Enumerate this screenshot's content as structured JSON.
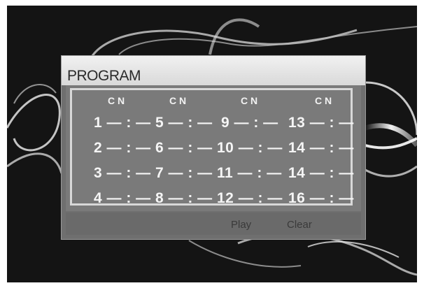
{
  "dialog": {
    "title": "PROGRAM",
    "columns": [
      "C N",
      "C N",
      "C N",
      "C N"
    ],
    "entries": [
      "1 — : —",
      "2 — : —",
      "3 — : —",
      "4 — : —",
      "5 — : —",
      "6 — : —",
      "7 — : —",
      "8 — : —",
      "9 — : —",
      "10 — : —",
      "11 — : —",
      "12 — : —",
      "13 — : —",
      "14 — : —",
      "14 — : —",
      "16 — : —"
    ],
    "buttons": {
      "play": "Play",
      "clear": "Clear"
    }
  },
  "colors": {
    "screen_bg": "#141414",
    "dialog_bg": "#6f6f6f",
    "header_bg": "#e6e6e6",
    "text": "#f5f5f5"
  }
}
